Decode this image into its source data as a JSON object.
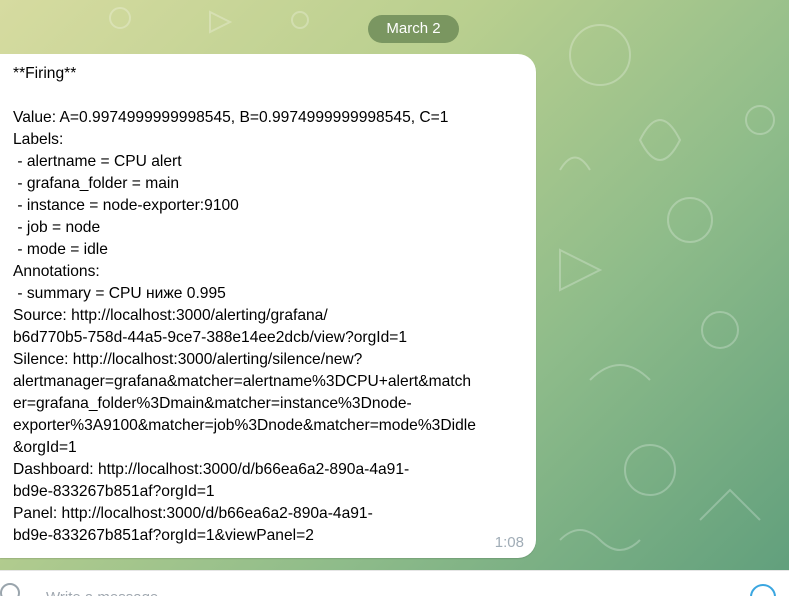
{
  "chat": {
    "date_label": "March 2",
    "message": {
      "lines": [
        "**Firing**",
        "",
        "Value: A=0.9974999999998545, B=0.9974999999998545, C=1",
        "Labels:",
        " - alertname = CPU alert",
        " - grafana_folder = main",
        " - instance = node-exporter:9100",
        " - job = node",
        " - mode = idle",
        "Annotations:",
        " - summary = CPU ниже 0.995",
        "Source: http://localhost:3000/alerting/grafana/",
        "b6d770b5-758d-44a5-9ce7-388e14ee2dcb/view?orgId=1",
        "Silence: http://localhost:3000/alerting/silence/new?",
        "alertmanager=grafana&matcher=alertname%3DCPU+alert&match",
        "er=grafana_folder%3Dmain&matcher=instance%3Dnode-",
        "exporter%3A9100&matcher=job%3Dnode&matcher=mode%3Didle",
        "&orgId=1",
        "Dashboard: http://localhost:3000/d/b66ea6a2-890a-4a91-",
        "bd9e-833267b851af?orgId=1",
        "Panel: http://localhost:3000/d/b66ea6a2-890a-4a91-",
        "bd9e-833267b851af?orgId=1&viewPanel=2"
      ],
      "time": "1:08"
    }
  },
  "composer": {
    "placeholder": "Write a message...",
    "attach_icon": "paperclip-icon",
    "emoji_icon": "smile-icon"
  },
  "colors": {
    "date_pill_bg": "#6f8c58",
    "bubble_bg": "#ffffff",
    "time_text": "#a0acb6"
  }
}
